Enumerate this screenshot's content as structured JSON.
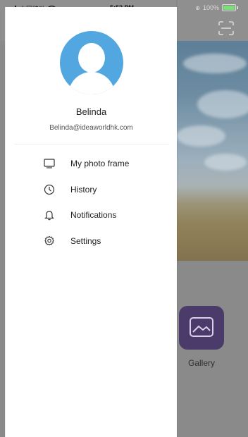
{
  "status_bar": {
    "carrier": "中国移动",
    "time": "5:53 PM",
    "battery": "100%"
  },
  "drawer": {
    "user": {
      "name": "Belinda",
      "email": "Belinda@ideaworldhk.com"
    },
    "menu": [
      {
        "label": "My photo frame",
        "icon": "monitor-icon"
      },
      {
        "label": "History",
        "icon": "clock-icon"
      },
      {
        "label": "Notifications",
        "icon": "bell-icon"
      },
      {
        "label": "Settings",
        "icon": "gear-icon"
      }
    ]
  },
  "background_app": {
    "gallery_label": "Gallery",
    "icons": [
      "scan-icon",
      "gallery-icon"
    ]
  },
  "colors": {
    "avatar_bg": "#52a7e0",
    "gallery_tile": "#4b3b6b",
    "overlay": "#8a8a8a"
  }
}
